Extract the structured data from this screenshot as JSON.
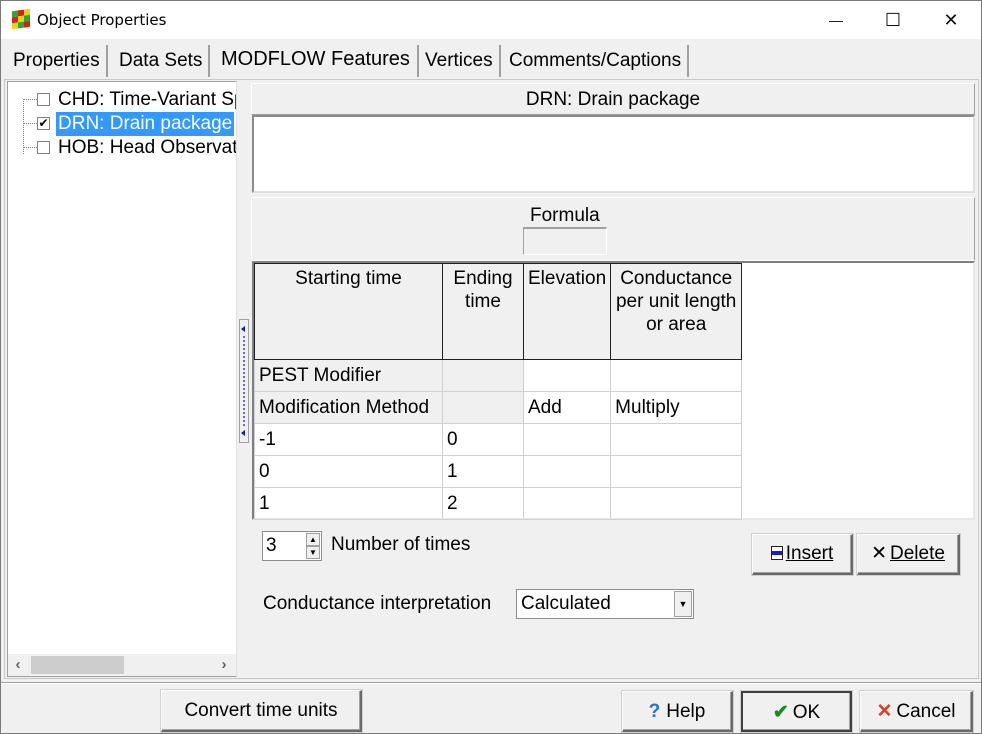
{
  "window": {
    "title": "Object Properties",
    "controls": {
      "minimize": "—",
      "maximize": "☐",
      "close": "✕"
    }
  },
  "tabs": [
    {
      "label": "Properties",
      "active": false
    },
    {
      "label": "Data Sets",
      "active": false
    },
    {
      "label": "MODFLOW Features",
      "active": true
    },
    {
      "label": "Vertices",
      "active": false
    },
    {
      "label": "Comments/Captions",
      "active": false
    }
  ],
  "tree": {
    "items": [
      {
        "label": "CHD: Time-Variant Specified Head",
        "checked": false,
        "selected": false
      },
      {
        "label": "DRN: Drain package",
        "checked": true,
        "selected": true
      },
      {
        "label": "HOB: Head Observations",
        "checked": false,
        "selected": false
      }
    ],
    "scroll_left": "‹",
    "scroll_right": "›"
  },
  "package": {
    "title": "DRN: Drain package",
    "description": ""
  },
  "formula": {
    "label": "Formula",
    "value": ""
  },
  "grid": {
    "columns": [
      "Starting time",
      "Ending time",
      "Elevation",
      "Conductance per unit length or area"
    ],
    "rows": [
      [
        "PEST Modifier",
        "",
        "",
        ""
      ],
      [
        "Modification Method",
        "",
        "Add",
        "Multiply"
      ],
      [
        "-1",
        "0",
        "",
        ""
      ],
      [
        "0",
        "1",
        "",
        ""
      ],
      [
        "1",
        "2",
        "",
        ""
      ]
    ]
  },
  "number_of_times": {
    "value": "3",
    "label": "Number of times"
  },
  "buttons": {
    "insert": "Insert",
    "delete": "Delete",
    "convert_time_units": "Convert time units",
    "help": "Help",
    "ok": "OK",
    "cancel": "Cancel"
  },
  "conductance_interpretation": {
    "label": "Conductance interpretation",
    "value": "Calculated"
  },
  "colors": {
    "selection": "#3399ff",
    "ok_check": "#1a8a1a",
    "cancel_x": "#d9412a",
    "help_q": "#2a6fd0"
  }
}
